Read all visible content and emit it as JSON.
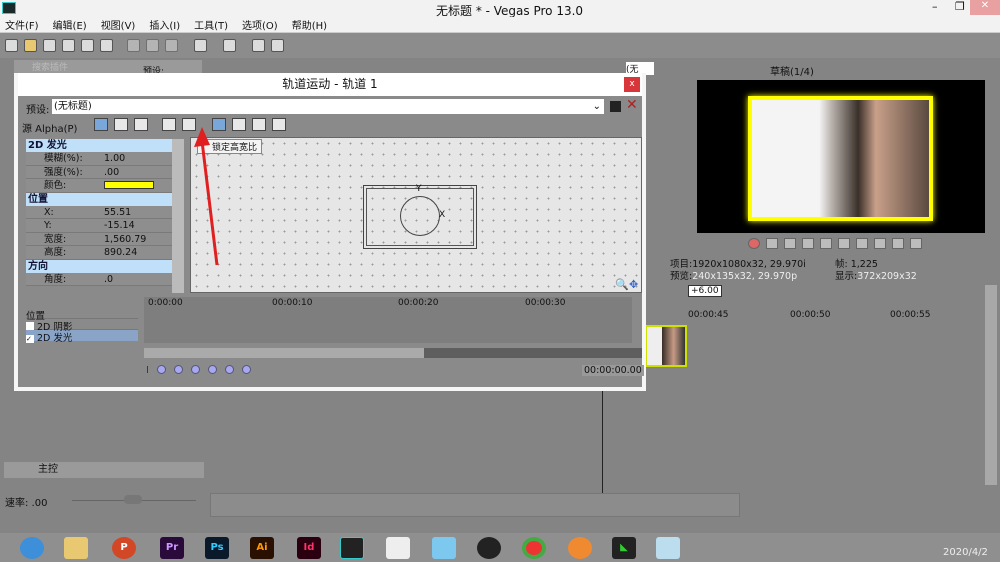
{
  "window": {
    "title": "无标题 * - Vegas Pro 13.0"
  },
  "menu": [
    "文件(F)",
    "编辑(E)",
    "视图(V)",
    "插入(I)",
    "工具(T)",
    "选项(O)",
    "帮助(H)"
  ],
  "explorer": {
    "search_placeholder": "搜索插件",
    "preset_label": "预设:",
    "preset_value": "(无"
  },
  "dialog": {
    "title": "轨道运动 - 轨道 1",
    "preset_label": "预设:",
    "preset_value": "(无标题)",
    "source_alpha": "源 Alpha(P)",
    "tooltip": "锁定高宽比",
    "sections": [
      {
        "name": "2D 发光",
        "props": [
          {
            "k": "模糊(%):",
            "v": "1.00"
          },
          {
            "k": "强度(%):",
            "v": ".00"
          },
          {
            "k": "颜色:",
            "v": "",
            "color": "#ffff00"
          }
        ]
      },
      {
        "name": "位置",
        "props": [
          {
            "k": "X:",
            "v": "55.51"
          },
          {
            "k": "Y:",
            "v": "-15.14"
          },
          {
            "k": "宽度:",
            "v": "1,560.79"
          },
          {
            "k": "高度:",
            "v": "890.24"
          }
        ]
      },
      {
        "name": "方向",
        "props": [
          {
            "k": "角度:",
            "v": ".0"
          }
        ]
      }
    ],
    "axis_y": "Y",
    "axis_x": "X",
    "tracks": [
      {
        "label": "位置",
        "checked": null
      },
      {
        "label": "2D 阴影",
        "checked": false
      },
      {
        "label": "2D 发光",
        "checked": true
      }
    ],
    "ruler": [
      "0:00:00",
      "00:00:10",
      "00:00:20",
      "00:00:30"
    ],
    "time": "00:00:00.00"
  },
  "preview": {
    "quality": "草稿(1/4)",
    "project_label": "项目:",
    "project_value": "1920x1080x32, 29.970i",
    "preview_label": "预览:",
    "preview_value": "240x135x32, 29.970p",
    "frame_label": "帧:",
    "frame_value": "1,225",
    "display_label": "显示:",
    "display_value": "372x209x32"
  },
  "timeline": {
    "offset": "+6.00",
    "ruler": [
      "00:00:45",
      "00:00:50",
      "00:00:55"
    ]
  },
  "master": {
    "label": "主控",
    "rate": "速率: .00"
  },
  "taskbar": {
    "apps": [
      "P",
      "Pr",
      "Ps",
      "Ai",
      "Id"
    ],
    "date": "2020/4/2"
  },
  "colors": {
    "glow": "#ffff00",
    "close": "#d9363b",
    "arrow": "#e02020"
  }
}
